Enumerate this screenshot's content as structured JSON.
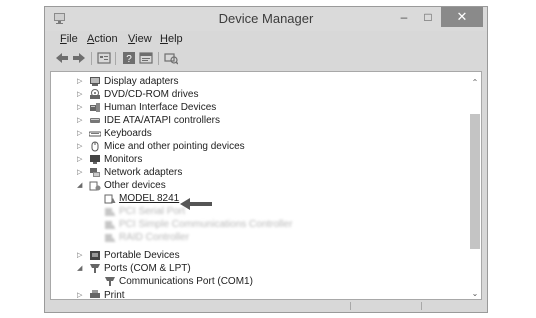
{
  "window": {
    "title": "Device Manager",
    "minimize_glyph": "–",
    "maximize_glyph": "□",
    "close_glyph": "✕"
  },
  "menu": {
    "file_ul": "F",
    "file_rest": "ile",
    "action_ul": "A",
    "action_rest": "ction",
    "view_ul": "V",
    "view_rest": "iew",
    "help_ul": "H",
    "help_rest": "elp"
  },
  "toolbar": {
    "icons": [
      "back-arrow-icon",
      "forward-arrow-icon",
      "properties-icon",
      "help-icon",
      "show-hidden-icon",
      "scan-hardware-icon"
    ]
  },
  "tree": {
    "display_adapters": "Display adapters",
    "dvd_drives": "DVD/CD-ROM drives",
    "hid": "Human Interface Devices",
    "ide": "IDE ATA/ATAPI controllers",
    "keyboards": "Keyboards",
    "mice": "Mice and other pointing devices",
    "monitors": "Monitors",
    "network": "Network adapters",
    "other_devices": "Other devices",
    "model": "MODEL 8241",
    "other_blur_1": "PCI Serial Port",
    "other_blur_2": "PCI Simple Communications Controller",
    "other_blur_3": "RAID Controller",
    "portable": "Portable Devices",
    "ports": "Ports (COM & LPT)",
    "com1": "Communications Port (COM1)",
    "cut_off": "Print"
  },
  "colors": {
    "titlebar": "#dadada",
    "window_frame": "#d8d8d8",
    "close_button": "#8a8a8a",
    "tree_background": "#ffffff",
    "scroll_thumb": "#c4c4c4",
    "callout_arrow": "#555555"
  }
}
